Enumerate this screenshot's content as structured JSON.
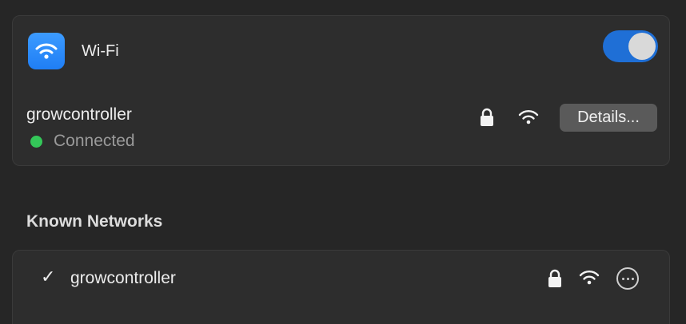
{
  "wifi": {
    "title": "Wi-Fi",
    "enabled": true,
    "accent_color": "#1f6fd6",
    "icon": "wifi-icon"
  },
  "current_network": {
    "name": "growcontroller",
    "status": "Connected",
    "status_color": "#34c759",
    "secured": true,
    "details_label": "Details..."
  },
  "known_networks": {
    "heading": "Known Networks",
    "items": [
      {
        "name": "growcontroller",
        "selected": true,
        "check": "✓",
        "secured": true
      }
    ]
  }
}
